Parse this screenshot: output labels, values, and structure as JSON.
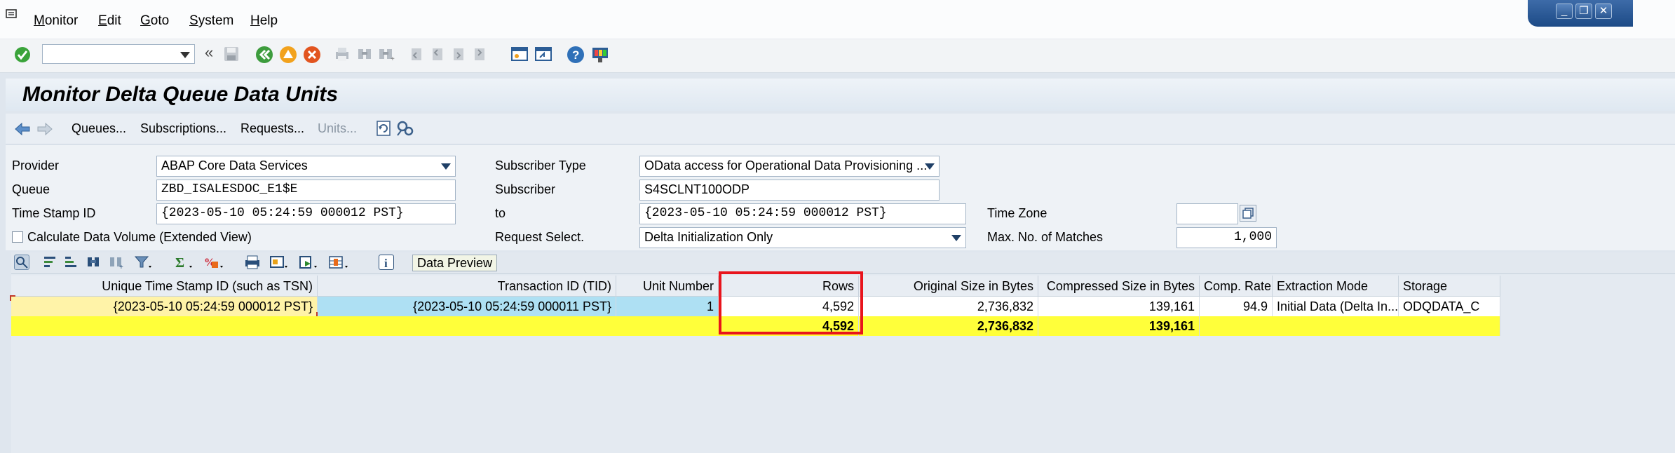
{
  "menu": {
    "items": [
      "Monitor",
      "Edit",
      "Goto",
      "System",
      "Help"
    ]
  },
  "window": {
    "minimize": "_",
    "maximize": "❐",
    "close": "✕"
  },
  "toolbar": {
    "command_field": "",
    "back_label": "«",
    "icons": [
      "enter-icon",
      "save-icon",
      "back-icon",
      "exit-icon",
      "cancel-icon",
      "print-icon",
      "find-icon",
      "find-next-icon",
      "first-page-icon",
      "previous-page-icon",
      "next-page-icon",
      "last-page-icon",
      "new-session-icon",
      "shortcut-icon",
      "help-icon",
      "customize-layout-icon"
    ]
  },
  "title": "Monitor Delta Queue Data Units",
  "app_toolbar": {
    "queues": "Queues...",
    "subscriptions": "Subscriptions...",
    "requests": "Requests...",
    "units": "Units..."
  },
  "form": {
    "provider_label": "Provider",
    "provider_value": "ABAP Core Data Services",
    "queue_label": "Queue",
    "queue_value": "ZBD_ISALESDOC_E1$E",
    "timestamp_label": "Time Stamp ID",
    "timestamp_value": "{2023-05-10 05:24:59 000012 PST}",
    "calc_volume_label": "Calculate Data Volume (Extended View)",
    "subscriber_type_label": "Subscriber Type",
    "subscriber_type_value": "OData access for Operational Data Provisioning ...",
    "subscriber_label": "Subscriber",
    "subscriber_value": "S4SCLNT100ODP",
    "to_label": "to",
    "to_value": "{2023-05-10 05:24:59 000012 PST}",
    "request_select_label": "Request Select.",
    "request_select_value": "Delta Initialization Only",
    "timezone_label": "Time Zone",
    "timezone_value": "",
    "max_matches_label": "Max. No. of Matches",
    "max_matches_value": "1,000"
  },
  "alv": {
    "data_preview": "Data Preview",
    "columns": [
      "Unique Time Stamp ID (such as TSN)",
      "Transaction ID (TID)",
      "Unit Number",
      "Rows",
      "Original Size in Bytes",
      "Compressed Size in Bytes",
      "Comp. Rate",
      "Extraction Mode",
      "Storage"
    ],
    "rows": [
      {
        "tsn": "{2023-05-10 05:24:59 000012 PST}",
        "tid": "{2023-05-10 05:24:59 000011 PST}",
        "unit": "1",
        "rows": "4,592",
        "orig": "2,736,832",
        "comp": "139,161",
        "rate": "94.9",
        "mode": "Initial Data (Delta In...",
        "storage": "ODQDATA_C"
      }
    ],
    "totals": {
      "rows": "4,592",
      "orig": "2,736,832",
      "comp": "139,161"
    }
  },
  "colors": {
    "highlight_box": "#e8141c",
    "total_row": "#ffff3a",
    "key_cell": "#fff3a8",
    "tid_cell": "#aee0f3"
  }
}
